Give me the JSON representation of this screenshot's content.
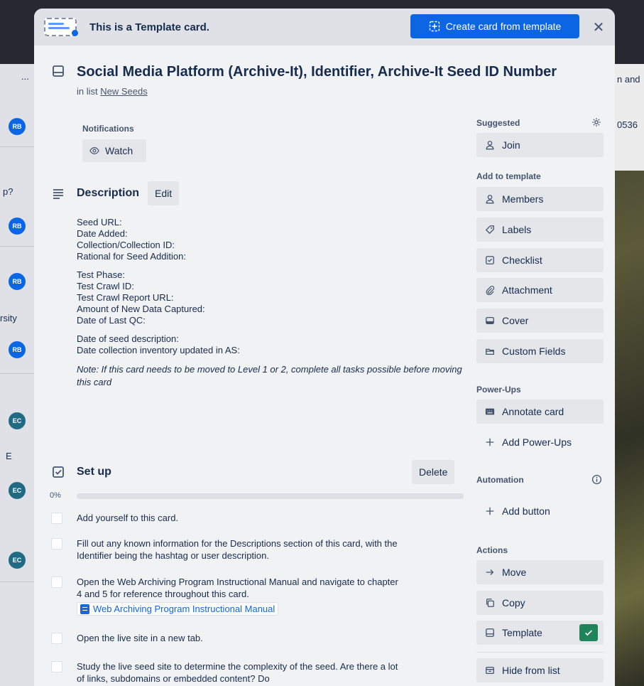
{
  "background": {
    "right_texts": [
      "n and",
      "0536"
    ],
    "left_texts": [
      "...",
      "p?",
      "rsity",
      "E"
    ],
    "avatars": [
      "RB",
      "RB",
      "RB",
      "RB",
      "EC",
      "EC",
      "EC"
    ]
  },
  "banner": {
    "title": "This is a Template card.",
    "create_label": "Create card from template",
    "close_glyph": "✕"
  },
  "card": {
    "title": "Social Media Platform (Archive-It), Identifier, Archive-It Seed ID Number",
    "in_list_prefix": "in list",
    "list_name": "New Seeds"
  },
  "notifications": {
    "label": "Notifications",
    "watch_label": "Watch"
  },
  "description": {
    "title": "Description",
    "edit_label": "Edit",
    "group1": [
      "Seed URL:",
      "Date Added:",
      "Collection/Collection ID:",
      "Rational for Seed Addition:"
    ],
    "group2": [
      "Test Phase:",
      "Test Crawl ID:",
      "Test Crawl Report URL:",
      "Amount of New Data Captured:",
      "Date of Last QC:"
    ],
    "group3": [
      "Date of seed description:",
      "Date collection inventory updated in AS:"
    ],
    "note": "Note: If this card needs to be moved to Level 1 or 2, complete all tasks possible before moving this card"
  },
  "checklist": {
    "title": "Set up",
    "delete_label": "Delete",
    "progress_label": "0%",
    "progress_fraction": 0,
    "items": [
      "Add yourself to this card.",
      "Fill out any known information for the Descriptions section of this card, with the Identifier being the hashtag or user description.",
      "Open the Web Archiving Program Instructional Manual and navigate to chapter 4 and 5 for reference throughout this card.",
      "Open the live site in a new tab.",
      "Study the live seed site to determine the complexity of the seed. Are there a lot of links, subdomains or embedded content? Do"
    ],
    "link_label": "Web Archiving Program Instructional Manual"
  },
  "sidebar": {
    "suggested_label": "Suggested",
    "join_label": "Join",
    "add_to_template_label": "Add to template",
    "members_label": "Members",
    "labels_label": "Labels",
    "checklist_label": "Checklist",
    "attachment_label": "Attachment",
    "cover_label": "Cover",
    "custom_fields_label": "Custom Fields",
    "power_ups_label": "Power-Ups",
    "annotate_label": "Annotate card",
    "add_power_ups_label": "Add Power-Ups",
    "automation_label": "Automation",
    "add_button_label": "Add button",
    "actions_label": "Actions",
    "move_label": "Move",
    "copy_label": "Copy",
    "template_label": "Template",
    "hide_label": "Hide from list"
  },
  "colors": {
    "primary": "#0c66e4",
    "success": "#1f845a",
    "surface": "#f1f2f4",
    "button": "#e4e6ea"
  }
}
